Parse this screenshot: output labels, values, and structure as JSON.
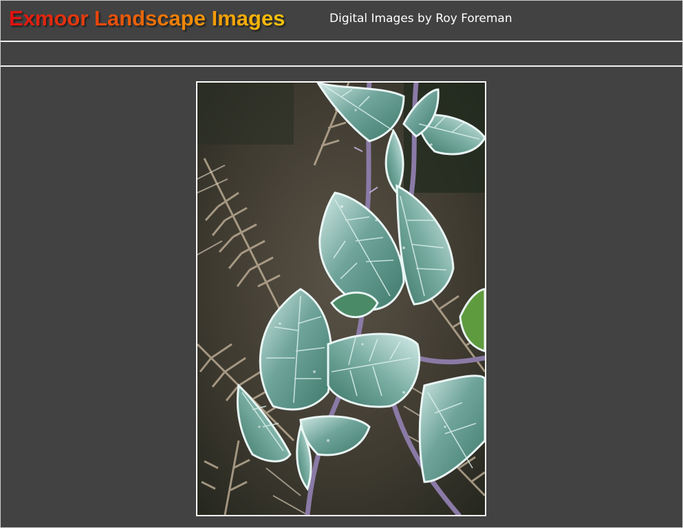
{
  "header": {
    "site_title": "Exmoor Landscape Images",
    "subtitle": "Digital Images by Roy Foreman"
  },
  "photo": {
    "subject": "frost-covered-bramble-leaves",
    "colors": {
      "background": "#424242",
      "title_gradient": [
        "#e01010",
        "#f08a08",
        "#f6c40a"
      ],
      "frame_border": "#ffffff"
    }
  }
}
